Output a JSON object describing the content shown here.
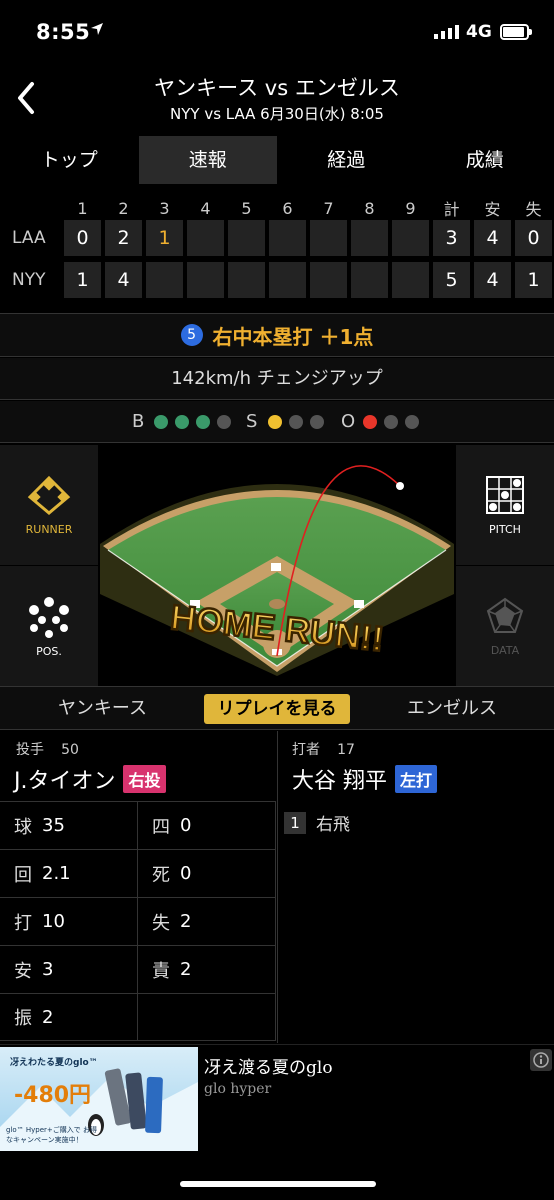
{
  "status_bar": {
    "time": "8:55",
    "network": "4G"
  },
  "header": {
    "title": "ヤンキース vs エンゼルス",
    "subtitle": "NYY vs LAA 6月30日(水) 8:05"
  },
  "tabs": [
    {
      "label": "トップ",
      "active": false
    },
    {
      "label": "速報",
      "active": true
    },
    {
      "label": "経過",
      "active": false
    },
    {
      "label": "成績",
      "active": false
    }
  ],
  "scoreboard": {
    "headers": [
      "1",
      "2",
      "3",
      "4",
      "5",
      "6",
      "7",
      "8",
      "9",
      "計",
      "安",
      "失"
    ],
    "rows": [
      {
        "team": "LAA",
        "innings": [
          "0",
          "2",
          "1",
          "",
          "",
          "",
          "",
          "",
          ""
        ],
        "totals": [
          "3",
          "4",
          "0"
        ]
      },
      {
        "team": "NYY",
        "innings": [
          "1",
          "4",
          "",
          "",
          "",
          "",
          "",
          "",
          ""
        ],
        "totals": [
          "5",
          "4",
          "1"
        ]
      }
    ]
  },
  "play": {
    "batter_number": "5",
    "result": "右中本塁打 ＋1点"
  },
  "pitch_info": "142km/h チェンジアップ",
  "count": {
    "b_label": "B",
    "s_label": "S",
    "o_label": "O",
    "balls": 3,
    "balls_max": 4,
    "strikes": 1,
    "strikes_max": 3,
    "outs": 1,
    "outs_max": 3,
    "colors": {
      "ball": "#3a9a6a",
      "strike": "#f0c030",
      "out": "#e8362a",
      "empty": "#555555"
    }
  },
  "side_buttons": {
    "runner": "RUNNER",
    "pos": "POS.",
    "pitch": "PITCH",
    "data": "DATA"
  },
  "field_text": "HOME RUN!!",
  "teams_bar": {
    "left": "ヤンキース",
    "replay": "リプレイを見る",
    "right": "エンゼルス"
  },
  "pitcher": {
    "role": "投手",
    "number": "50",
    "name": "J.タイオン",
    "hand": "右投",
    "hand_color": "#d8336e"
  },
  "batter": {
    "role": "打者",
    "number": "17",
    "name": "大谷 翔平",
    "hand": "左打",
    "hand_color": "#2e66d6"
  },
  "pitcher_stats": [
    [
      {
        "k": "球",
        "v": "35"
      },
      {
        "k": "四",
        "v": "0"
      }
    ],
    [
      {
        "k": "回",
        "v": "2.1"
      },
      {
        "k": "死",
        "v": "0"
      }
    ],
    [
      {
        "k": "打",
        "v": "10"
      },
      {
        "k": "失",
        "v": "2"
      }
    ],
    [
      {
        "k": "安",
        "v": "3"
      },
      {
        "k": "責",
        "v": "2"
      }
    ],
    [
      {
        "k": "振",
        "v": "2"
      },
      {
        "k": "",
        "v": ""
      }
    ]
  ],
  "at_bats": [
    {
      "n": "1",
      "result": "右飛"
    }
  ],
  "ad": {
    "title": "冴え渡る夏のglo",
    "sub": "glo hyper",
    "img_text1": "冴えわたる夏のglo™",
    "img_price": "-480円",
    "img_text2": "glo™ Hyper+ご購入で お得なキャンペーン実施中！"
  }
}
